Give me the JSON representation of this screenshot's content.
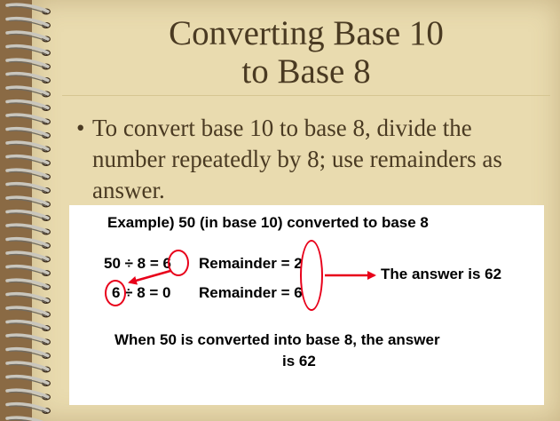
{
  "slide": {
    "title_line1": "Converting Base 10",
    "title_line2": "to Base 8",
    "bullet_symbol": "•",
    "bullet_text": "To convert base 10 to base 8, divide the number repeatedly by 8; use remainders as answer."
  },
  "example": {
    "heading": "Example) 50 (in base 10) converted to base 8",
    "row1_expr": "50 ÷ 8 = 6",
    "row1_remainder": "Remainder = 2",
    "row2_expr": "6 ÷ 8 = 0",
    "row2_remainder": "Remainder = 6",
    "answer_label": "The answer is 62",
    "conclusion_line1": "When 50 is converted into base 8, the answer",
    "conclusion_line2": "is 62"
  },
  "colors": {
    "page": "#e9dbaf",
    "title_text": "#4a3a22",
    "highlight_red": "#e8001a"
  }
}
